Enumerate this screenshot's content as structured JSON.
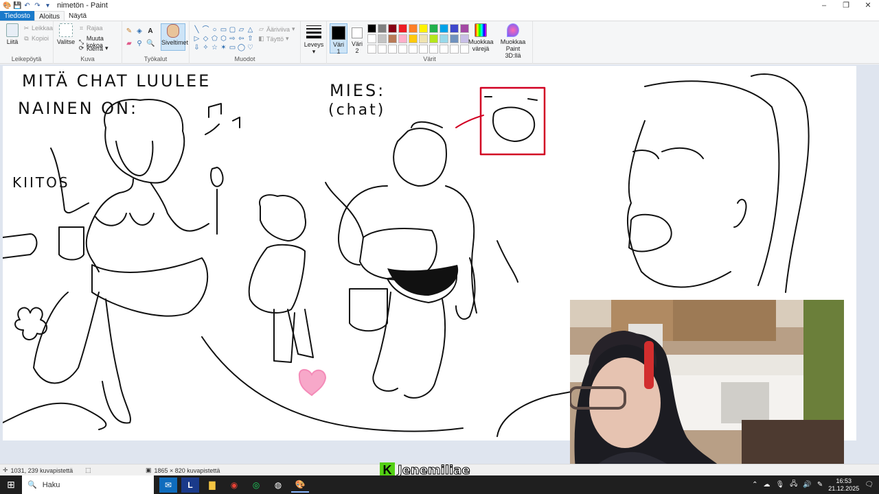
{
  "window": {
    "title": "nimetön - Paint",
    "controls": [
      "–",
      "❐",
      "✕"
    ]
  },
  "tabs": [
    "Tiedosto",
    "Aloitus",
    "Näytä"
  ],
  "ribbon": {
    "clipboard": {
      "name": "Leikepöytä",
      "paste": "Liitä",
      "cut": "Leikkaa",
      "copy": "Kopioi"
    },
    "image": {
      "name": "Kuva",
      "select": "Valitse",
      "crop": "Rajaa",
      "resize": "Muuta kokoa",
      "rotate": "Kierrä"
    },
    "tools": {
      "name": "Työkalut",
      "brushes": "Siveltimet"
    },
    "shapes": {
      "name": "Muodot",
      "outline": "Ääriviiva",
      "fill": "Täyttö",
      "glyphs": [
        "╲",
        "⌒",
        "○",
        "▭",
        "▢",
        "▱",
        "△",
        "▷",
        "◇",
        "⬠",
        "⬡",
        "⇨",
        "⇦",
        "⇧",
        "⇩",
        "✧",
        "☆",
        "✶",
        "▭",
        "◯",
        "♡",
        "ϟ",
        "▱",
        "⚡",
        "◠",
        "◡",
        "☁",
        "☐"
      ]
    },
    "size": {
      "label": "Leveys"
    },
    "colors": {
      "name": "Värit",
      "color1": "Väri 1",
      "color2": "Väri 2",
      "edit": "Muokkaa värejä",
      "paint3d": "Muokkaa Paint 3D:llä",
      "palette": [
        "#000000",
        "#7f7f7f",
        "#880015",
        "#ed1c24",
        "#ff7f27",
        "#fff200",
        "#22b14c",
        "#00a2e8",
        "#3f48cc",
        "#a349a4",
        "#ffffff",
        "#c3c3c3",
        "#b97a57",
        "#ffaec9",
        "#ffc90e",
        "#efe4b0",
        "#b5e61d",
        "#99d9ea",
        "#7092be",
        "#c8bfe7",
        "#ffffff",
        "#ffffff",
        "#ffffff",
        "#ffffff",
        "#ffffff",
        "#ffffff",
        "#ffffff",
        "#ffffff",
        "#ffffff",
        "#ffffff"
      ],
      "active1": "#000000",
      "active2": "#ffffff"
    }
  },
  "canvas": {
    "text_top_left_1": "MITÄ CHAT LUULEE",
    "text_top_left_2": "NAINEN ON:",
    "text_kiitos": "KIITOS",
    "text_mies": "MIES:",
    "text_chat": "(chat)"
  },
  "status": {
    "cursor": "1031, 239 kuvapistettä",
    "size": "1865 × 820 kuvapistettä"
  },
  "overlay": {
    "streamer": "Jenemiliae",
    "logo_letter": "K"
  },
  "taskbar": {
    "search": "Haku",
    "time": "16:53",
    "date": "21.12.2025"
  }
}
